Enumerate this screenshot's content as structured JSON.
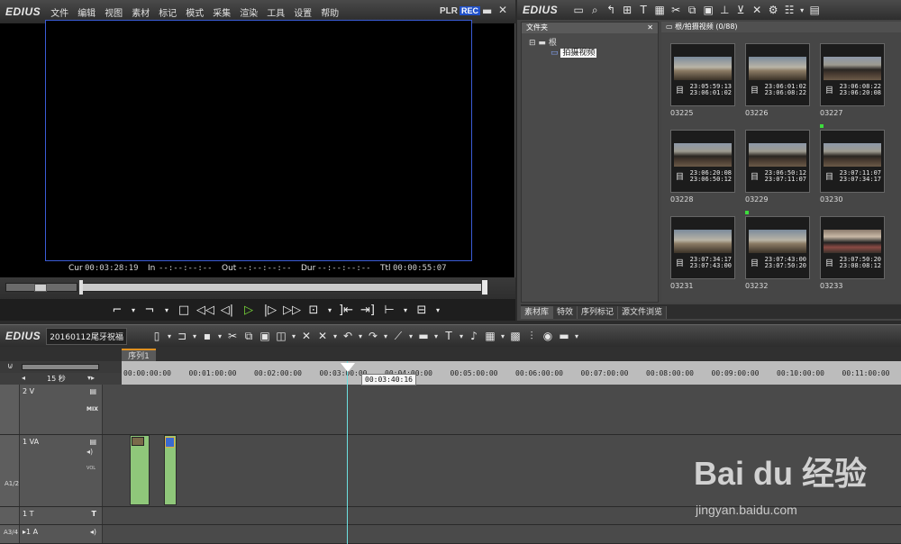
{
  "player": {
    "brand": "EDIUS",
    "menu": [
      "文件",
      "编辑",
      "视图",
      "素材",
      "标记",
      "模式",
      "采集",
      "渲染",
      "工具",
      "设置",
      "帮助"
    ],
    "plr": "PLR",
    "rec": "REC",
    "timecodes": {
      "cur_label": "Cur",
      "cur": "00:03:28:19",
      "in_label": "In",
      "in": "--:--:--:--",
      "out_label": "Out",
      "out": "--:--:--:--",
      "dur_label": "Dur",
      "dur": "--:--:--:--",
      "ttl_label": "Ttl",
      "ttl": "00:00:55:07"
    }
  },
  "bin": {
    "brand": "EDIUS",
    "folder_panel_title": "文件夹",
    "root_label": "根",
    "subfolder_label": "拍摄视频",
    "grid_title": "根/拍摄视频 (0/88)",
    "clips": [
      {
        "name": "03225",
        "tc_in": "23:05:59:13",
        "tc_out": "23:06:01:02",
        "style": "building"
      },
      {
        "name": "03226",
        "tc_in": "23:06:01:02",
        "tc_out": "23:06:08:22",
        "style": "building"
      },
      {
        "name": "03227",
        "tc_in": "23:06:08:22",
        "tc_out": "23:06:20:08",
        "style": "crowd"
      },
      {
        "name": "03228",
        "tc_in": "23:06:20:08",
        "tc_out": "23:06:50:12",
        "style": "crowd"
      },
      {
        "name": "03229",
        "tc_in": "23:06:50:12",
        "tc_out": "23:07:11:07",
        "style": "crowd"
      },
      {
        "name": "03230",
        "tc_in": "23:07:11:07",
        "tc_out": "23:07:34:17",
        "style": "crowd",
        "dot": true
      },
      {
        "name": "03231",
        "tc_in": "23:07:34:17",
        "tc_out": "23:07:43:00",
        "style": "building"
      },
      {
        "name": "03232",
        "tc_in": "23:07:43:00",
        "tc_out": "23:07:50:20",
        "style": "building",
        "dot": true
      },
      {
        "name": "03233",
        "tc_in": "23:07:50:20",
        "tc_out": "23:08:08:12",
        "style": "indoor"
      }
    ],
    "tabs": [
      "素材库",
      "特效",
      "序列标记",
      "源文件浏览"
    ]
  },
  "timeline": {
    "brand": "EDIUS",
    "project": "20160112尾牙祝福",
    "sequence_tab": "序列1",
    "scale": "15 秒",
    "ruler": [
      "00:00:00:00",
      "00:01:00:00",
      "00:02:00:00",
      "00:03:00:00",
      "00:04:00:00",
      "00:05:00:00",
      "00:06:00:00",
      "00:07:00:00",
      "00:08:00:00",
      "00:09:00:00",
      "00:10:00:00",
      "00:11:00:00"
    ],
    "cursor_tc": "00:03:40:16",
    "tracks": [
      {
        "name": "2 V",
        "extra": "MIX"
      },
      {
        "name": "1 VA",
        "extra": "VOL"
      },
      {
        "name": "1 T",
        "extra": ""
      },
      {
        "name": "▸1 A",
        "extra": ""
      }
    ],
    "side_labels": {
      "a12": "A1/2",
      "a34": "A3/4"
    }
  },
  "watermark": {
    "main": "Bai du 经验",
    "url": "jingyan.baidu.com"
  }
}
